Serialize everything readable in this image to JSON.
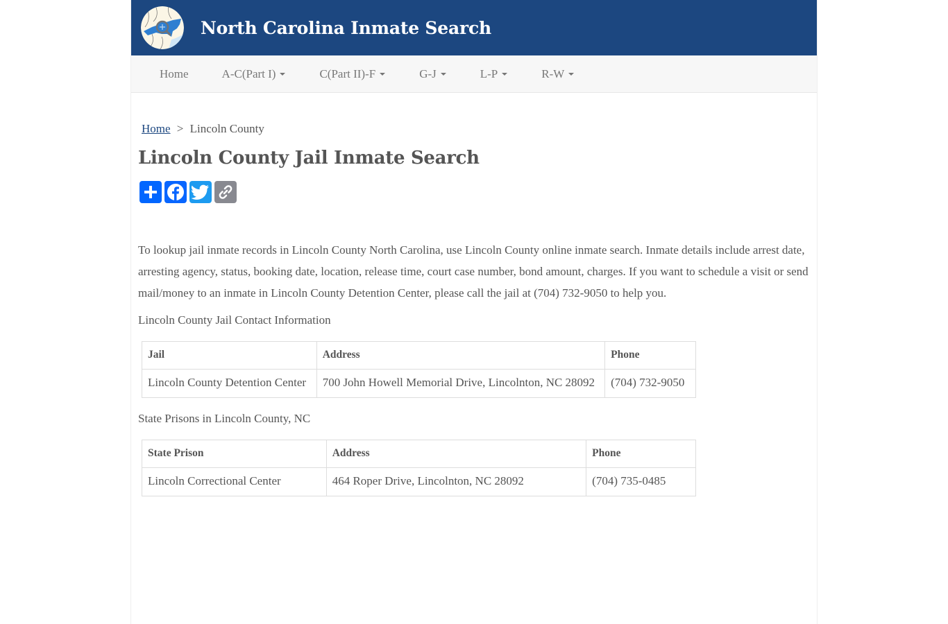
{
  "header": {
    "site_title": "North Carolina Inmate Search",
    "logo_icon": "nc-map-magnifier-logo",
    "brand_color": "#1c4780"
  },
  "nav": {
    "items": [
      {
        "label": "Home",
        "dropdown": false
      },
      {
        "label": "A-C(Part I)",
        "dropdown": true
      },
      {
        "label": "C(Part II)-F",
        "dropdown": true
      },
      {
        "label": "G-J",
        "dropdown": true
      },
      {
        "label": "L-P",
        "dropdown": true
      },
      {
        "label": "R-W",
        "dropdown": true
      }
    ]
  },
  "breadcrumb": {
    "home": "Home",
    "separator": ">",
    "current": "Lincoln County"
  },
  "page": {
    "title": "Lincoln County Jail Inmate Search",
    "share_buttons": [
      {
        "name": "share-add",
        "icon": "plus-icon",
        "color": "#0166ff"
      },
      {
        "name": "facebook",
        "icon": "facebook-icon",
        "color": "#0866ff"
      },
      {
        "name": "twitter",
        "icon": "twitter-icon",
        "color": "#1d9bf0"
      },
      {
        "name": "copy-link",
        "icon": "link-icon",
        "color": "#888990"
      }
    ],
    "intro": "To lookup jail inmate records in Lincoln County North Carolina, use Lincoln County online inmate search. Inmate details include arrest date, arresting agency, status, booking date, location, release time, court case number, bond amount, charges. If you want to schedule a visit or send mail/money to an inmate in Lincoln County Detention Center, please call the jail at (704) 732-9050 to help you."
  },
  "jail_contact": {
    "heading": "Lincoln County Jail Contact Information",
    "columns": [
      "Jail",
      "Address",
      "Phone"
    ],
    "rows": [
      [
        "Lincoln County Detention Center",
        "700 John Howell Memorial Drive, Lincolnton, NC 28092",
        "(704) 732-9050"
      ]
    ]
  },
  "state_prisons": {
    "heading": "State Prisons in Lincoln County, NC",
    "columns": [
      "State Prison",
      "Address",
      "Phone"
    ],
    "rows": [
      [
        "Lincoln Correctional Center",
        "464 Roper Drive, Lincolnton, NC 28092",
        "(704) 735-0485"
      ]
    ]
  }
}
